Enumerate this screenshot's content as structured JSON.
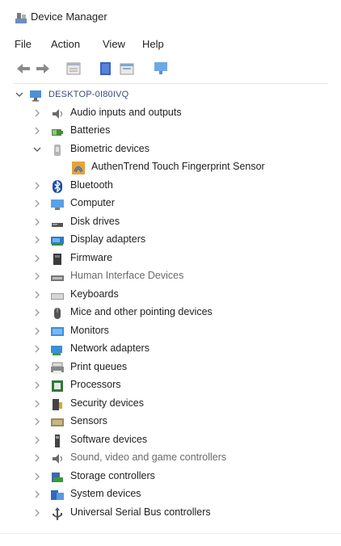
{
  "window": {
    "title": "Device Manager"
  },
  "menu": [
    "File",
    "Action",
    "View",
    "Help"
  ],
  "toolbar": [
    {
      "icon": "back-arrow-icon"
    },
    {
      "icon": "forward-arrow-icon"
    },
    {
      "icon": "properties-icon"
    },
    {
      "icon": "help-icon"
    },
    {
      "icon": "update-driver-icon"
    },
    {
      "icon": "monitor-icon"
    }
  ],
  "tree": {
    "root": "DESKTOP-0I80IVQ",
    "categories": [
      {
        "label": "Audio inputs and outputs",
        "icon": "speaker-icon",
        "expanded": false
      },
      {
        "label": "Batteries",
        "icon": "battery-icon",
        "expanded": false
      },
      {
        "label": "Biometric devices",
        "icon": "biometric-icon",
        "expanded": true,
        "children": [
          "AuthenTrend Touch Fingerprint Sensor"
        ]
      },
      {
        "label": "Bluetooth",
        "icon": "bluetooth-icon",
        "expanded": false
      },
      {
        "label": "Computer",
        "icon": "computer-icon",
        "expanded": false
      },
      {
        "label": "Disk drives",
        "icon": "disk-drive-icon",
        "expanded": false
      },
      {
        "label": "Display adapters",
        "icon": "display-adapter-icon",
        "expanded": false
      },
      {
        "label": "Firmware",
        "icon": "firmware-icon",
        "expanded": false
      },
      {
        "label": "Human Interface Devices",
        "icon": "hid-icon",
        "expanded": false
      },
      {
        "label": "Keyboards",
        "icon": "keyboard-icon",
        "expanded": false
      },
      {
        "label": "Mice and other pointing devices",
        "icon": "mouse-icon",
        "expanded": false
      },
      {
        "label": "Monitors",
        "icon": "monitor-icon",
        "expanded": false
      },
      {
        "label": "Network adapters",
        "icon": "network-adapter-icon",
        "expanded": false
      },
      {
        "label": "Print queues",
        "icon": "printer-icon",
        "expanded": false
      },
      {
        "label": "Processors",
        "icon": "processor-icon",
        "expanded": false
      },
      {
        "label": "Security devices",
        "icon": "security-device-icon",
        "expanded": false
      },
      {
        "label": "Sensors",
        "icon": "sensor-icon",
        "expanded": false
      },
      {
        "label": "Software devices",
        "icon": "software-device-icon",
        "expanded": false
      },
      {
        "label": "Sound, video and game controllers",
        "icon": "sound-video-icon",
        "expanded": false
      },
      {
        "label": "Storage controllers",
        "icon": "storage-controller-icon",
        "expanded": false
      },
      {
        "label": "System devices",
        "icon": "system-device-icon",
        "expanded": false
      },
      {
        "label": "Universal Serial Bus controllers",
        "icon": "usb-icon",
        "expanded": false
      }
    ]
  }
}
